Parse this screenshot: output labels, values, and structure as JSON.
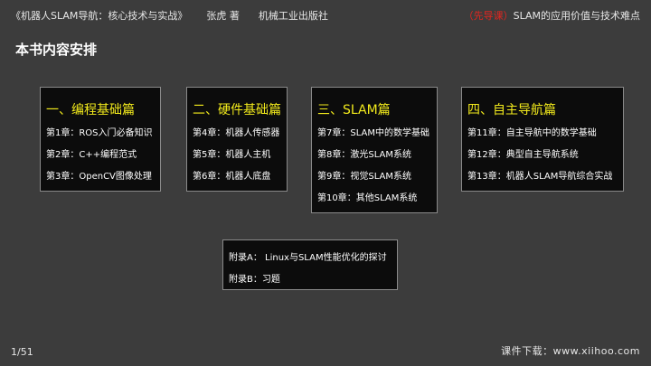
{
  "header": {
    "book_title": "《机器人SLAM导航：核心技术与实战》",
    "author": "张虎 著",
    "publisher": "机械工业出版社",
    "badge": "（先导课）",
    "course_title": "SLAM的应用价值与技术难点"
  },
  "section_title": "本书内容安排",
  "boxes": [
    {
      "title": "一、编程基础篇",
      "items": [
        "第1章：ROS入门必备知识",
        "第2章：C++编程范式",
        "第3章：OpenCV图像处理"
      ]
    },
    {
      "title": "二、硬件基础篇",
      "items": [
        "第4章：机器人传感器",
        "第5章：机器人主机",
        "第6章：机器人底盘"
      ]
    },
    {
      "title": "三、SLAM篇",
      "items": [
        "第7章：SLAM中的数学基础",
        "第8章：激光SLAM系统",
        "第9章：视觉SLAM系统",
        "第10章：其他SLAM系统"
      ]
    },
    {
      "title": "四、自主导航篇",
      "items": [
        "第11章：自主导航中的数学基础",
        "第12章：典型自主导航系统",
        "第13章：机器人SLAM导航综合实战"
      ]
    }
  ],
  "appendix": {
    "items": [
      "附录A： Linux与SLAM性能优化的探讨",
      "附录B：习题"
    ]
  },
  "footer": {
    "page": "1/51",
    "download": "课件下载：www.xiihoo.com"
  }
}
